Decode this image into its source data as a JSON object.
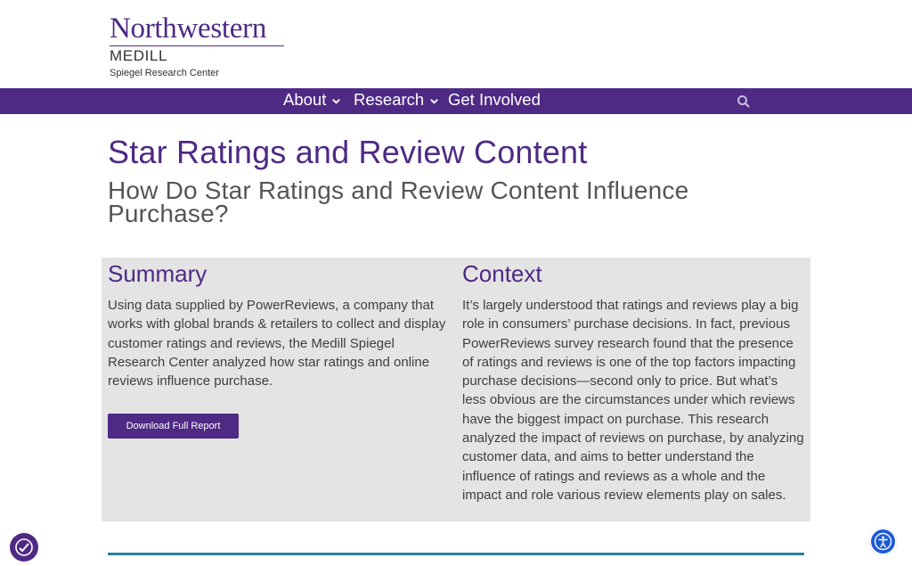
{
  "brand": {
    "university": "Northwestern",
    "school": "MEDILL",
    "center": "Spiegel Research Center"
  },
  "nav": {
    "items": [
      {
        "label": "About",
        "has_dropdown": true
      },
      {
        "label": "Research",
        "has_dropdown": true
      },
      {
        "label": "Get Involved",
        "has_dropdown": false
      }
    ],
    "search_icon": "search-icon"
  },
  "page": {
    "title": "Star Ratings and Review Content",
    "subtitle": "How Do Star Ratings and Review Content Influence Purchase?"
  },
  "summary": {
    "heading": "Summary",
    "text": "Using data supplied by PowerReviews, a company that works with global brands & retailers to collect and display customer ratings and reviews, the Medill Spiegel Research Center analyzed how star ratings and online reviews influence purchase.",
    "button_label": "Download Full Report"
  },
  "context": {
    "heading": "Context",
    "text": "It’s largely understood that ratings and reviews play a big role in consumers’ purchase decisions. In fact, previous PowerReviews survey research found that the presence of ratings and reviews is one of the top factors impacting purchase decisions—second only to price. But what’s less obvious are the circumstances under which reviews have the biggest impact on purchase. This research analyzed the impact of reviews on purchase, by analyzing customer data, and aims to better understand the influence of ratings and reviews as a whole and the impact and role various review elements play on sales."
  },
  "colors": {
    "brand_purple": "#4e2a84",
    "panel_gray": "#e4e4e4",
    "accessibility_blue": "#1f5ad6",
    "rule_teal": "#2b7f9a"
  }
}
